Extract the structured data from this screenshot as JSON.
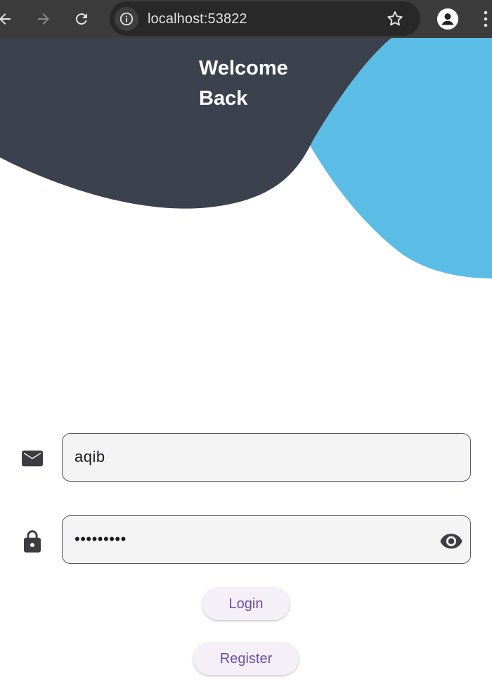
{
  "browser": {
    "url": "localhost:53822",
    "icons": [
      "back-arrow-icon",
      "forward-arrow-icon",
      "reload-icon",
      "info-icon",
      "star-icon",
      "profile-icon",
      "more-vert-icon"
    ]
  },
  "hero": {
    "title_line1": "Welcome",
    "title_line2": "Back",
    "colors": {
      "dark_blob": "#3b414d",
      "blue_blob": "#5bbde6"
    }
  },
  "form": {
    "email": {
      "value": "aqib",
      "icon": "email-icon"
    },
    "password": {
      "value": "•••••••••",
      "icon": "lock-icon",
      "toggle_icon": "eye-icon"
    },
    "login_label": "Login",
    "register_label": "Register",
    "accent": "#6750a4"
  }
}
